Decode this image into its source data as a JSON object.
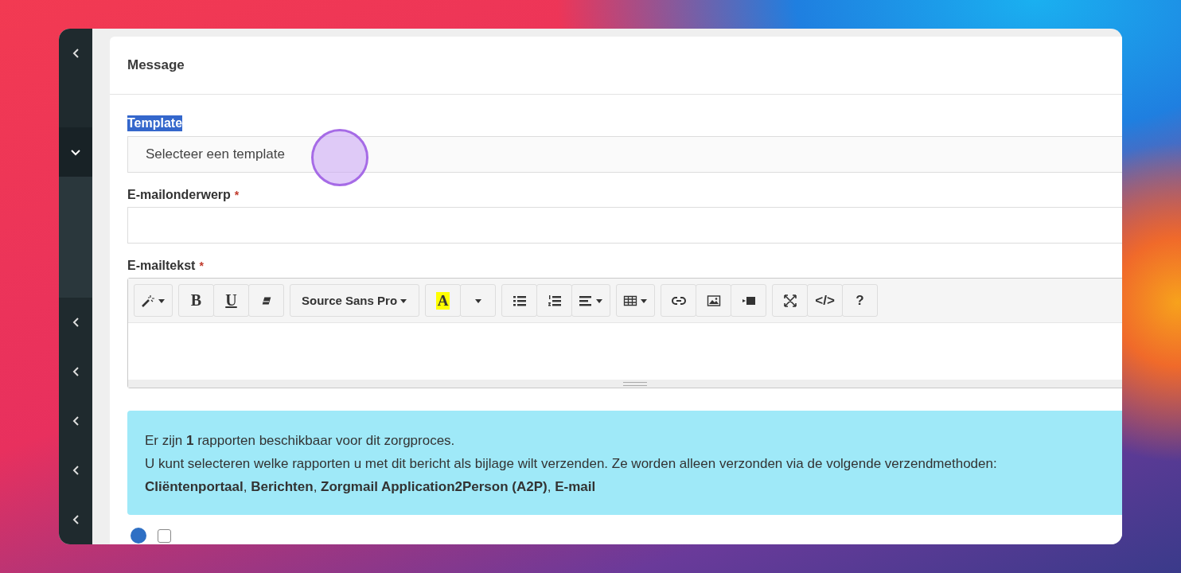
{
  "sidebar": {
    "items": [
      {
        "expanded": false
      },
      {
        "expanded": true
      },
      {
        "expanded": false
      },
      {
        "expanded": false
      },
      {
        "expanded": false
      },
      {
        "expanded": false
      },
      {
        "expanded": false
      }
    ]
  },
  "card": {
    "title": "Message"
  },
  "form": {
    "template": {
      "label": "Template",
      "label_selected": true,
      "placeholder": "Selecteer een template"
    },
    "subject": {
      "label": "E-mailonderwerp",
      "required_mark": "*"
    },
    "body": {
      "label": "E-mailtekst",
      "required_mark": "*"
    }
  },
  "toolbar": {
    "groups": [
      {
        "buttons": [
          {
            "kind": "magic"
          }
        ]
      },
      {
        "buttons": [
          {
            "kind": "bold",
            "label": "B"
          },
          {
            "kind": "underline",
            "label": "U"
          },
          {
            "kind": "eraser"
          }
        ]
      },
      {
        "buttons": [
          {
            "kind": "dropdown",
            "label": "Source Sans Pro"
          }
        ]
      },
      {
        "buttons": [
          {
            "kind": "highlight",
            "label": "A"
          },
          {
            "kind": "caret"
          }
        ]
      },
      {
        "buttons": [
          {
            "kind": "bullets"
          },
          {
            "kind": "numbers"
          },
          {
            "kind": "align"
          }
        ]
      },
      {
        "buttons": [
          {
            "kind": "table"
          }
        ]
      },
      {
        "buttons": [
          {
            "kind": "link"
          },
          {
            "kind": "image"
          },
          {
            "kind": "video"
          }
        ]
      },
      {
        "buttons": [
          {
            "kind": "fullscreen"
          },
          {
            "kind": "text",
            "label": "</>"
          },
          {
            "kind": "text",
            "label": "?"
          }
        ]
      }
    ]
  },
  "info": {
    "lines": [
      "Er zijn **1** rapporten beschikbaar voor dit zorgproces.",
      "U kunt selecteren welke rapporten u met dit bericht als bijlage wilt verzenden. Ze worden alleen verzonden via de volgende verzendmethoden:",
      "**Cliëntenportaal**, **Berichten**, **Zorgmail Application2Person (A2P)**, **E-mail**"
    ]
  },
  "reports": [
    {
      "checked": false
    }
  ]
}
